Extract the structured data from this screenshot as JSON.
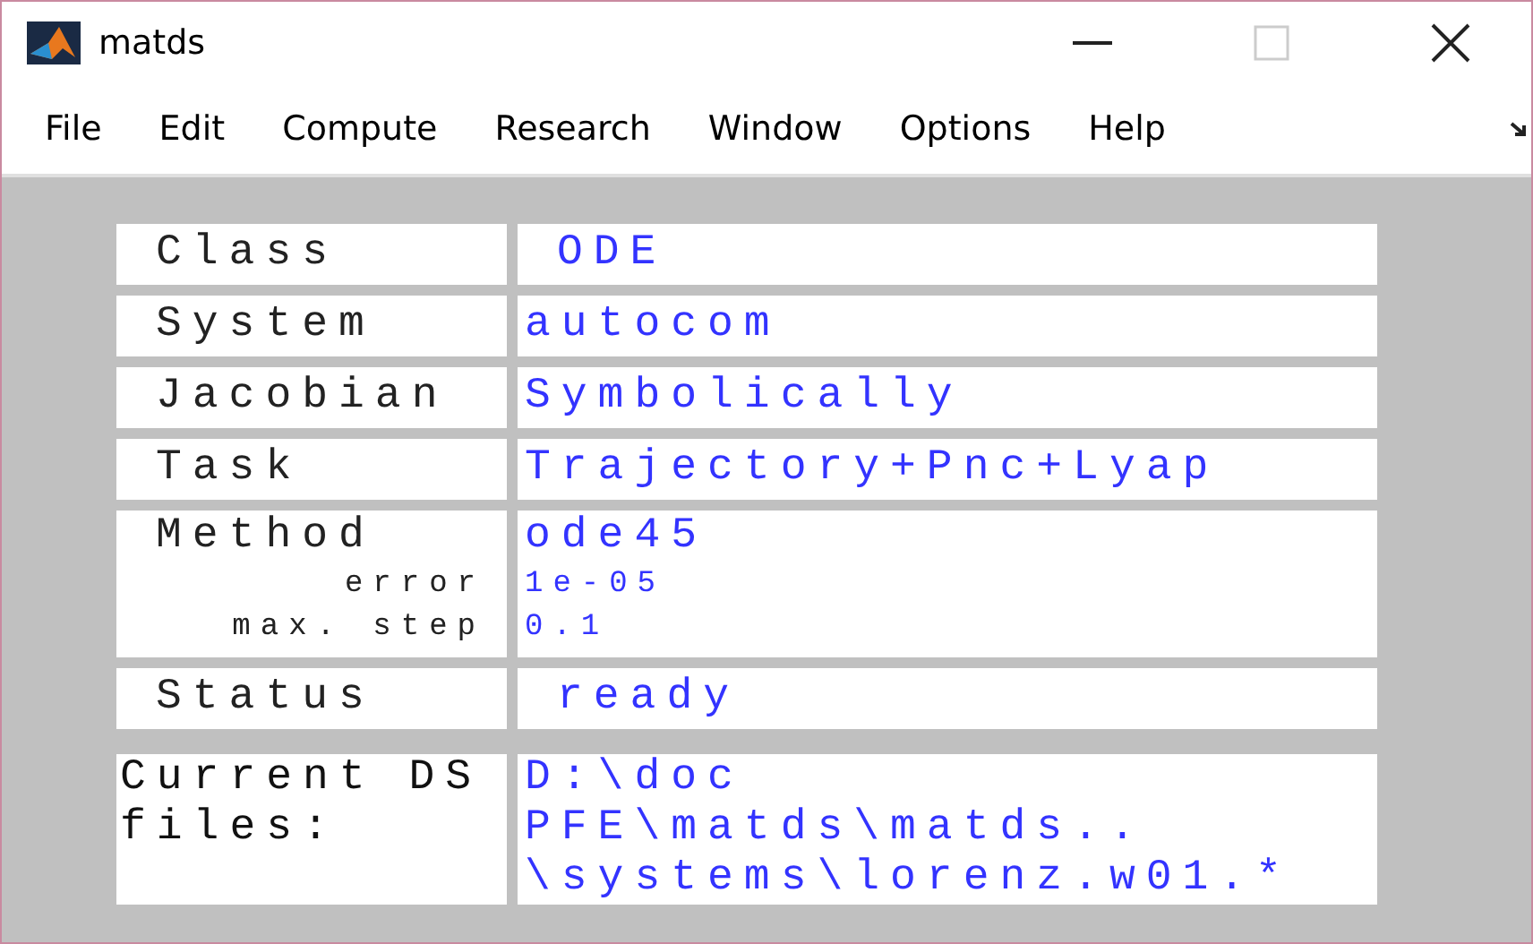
{
  "window": {
    "title": "matds"
  },
  "menu": [
    "File",
    "Edit",
    "Compute",
    "Research",
    "Window",
    "Options",
    "Help"
  ],
  "rows": [
    {
      "kind": "simple",
      "label": "Class",
      "value": "ODE",
      "indent": true
    },
    {
      "kind": "simple",
      "label": "System",
      "value": "autocom",
      "indent": false
    },
    {
      "kind": "simple",
      "label": "Jacobian",
      "value": "Symbolically",
      "indent": false
    },
    {
      "kind": "simple",
      "label": "Task",
      "value": "Trajectory+Pnc+Lyap",
      "indent": false
    },
    {
      "kind": "method",
      "label": "Method",
      "value": "ode45",
      "params": [
        {
          "label": "error",
          "value": "1e-05"
        },
        {
          "label": "max. step",
          "value": "0.1"
        }
      ]
    },
    {
      "kind": "simple",
      "label": "Status",
      "value": "ready",
      "indent": true
    },
    {
      "kind": "files",
      "label": "Current DS files:",
      "lines": [
        "D:\\doc",
        "PFE\\matds\\matds..",
        "\\systems\\lorenz.w01.*"
      ]
    }
  ]
}
